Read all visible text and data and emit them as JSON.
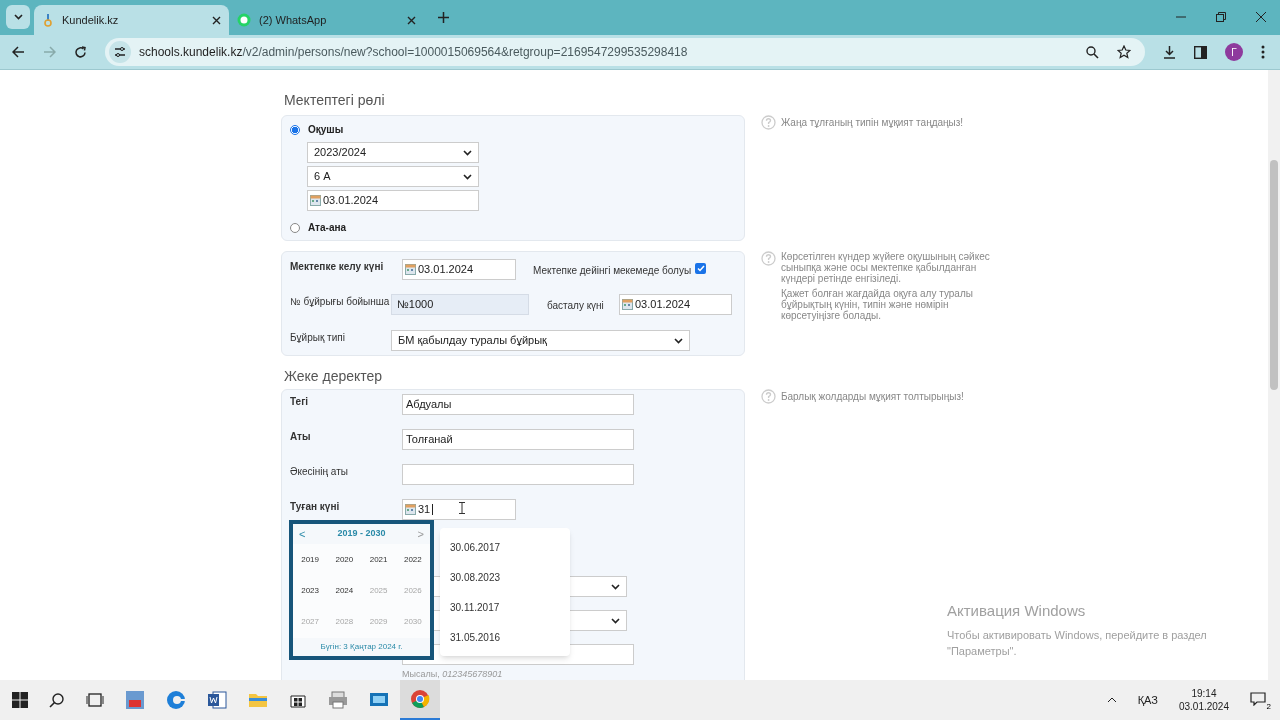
{
  "browser": {
    "tabs": [
      {
        "title": "Kundelik.kz",
        "selected": true,
        "kind": "site"
      },
      {
        "title": "(2) WhatsApp",
        "selected": false,
        "kind": "chat"
      }
    ],
    "url_host": "schools.kundelik.kz",
    "url_path": "/v2/admin/persons/new?school=1000015069564&retgroup=2169547299535298418",
    "profile_initial": "Г"
  },
  "role_section": {
    "heading": "Мектептегі рөлі",
    "hint": "Жаңа тұлғаның типін мұқият таңдаңыз!",
    "options": [
      {
        "label": "Оқушы",
        "selected": true
      },
      {
        "label": "Ата-ана",
        "selected": false
      }
    ],
    "year": "2023/2024",
    "class": "6 А",
    "date": "03.01.2024"
  },
  "admission": {
    "arrival_label": "Мектепке келу күні",
    "arrival_date": "03.01.2024",
    "preschool_label": "Мектепке дейінгі мекемеде болуы",
    "preschool_checked": true,
    "order_label": "№ бұйрығы бойынша",
    "order_number": "№1000",
    "start_label": "басталу күні",
    "start_date": "03.01.2024",
    "type_label": "Бұйрық типі",
    "type_value": "БМ қабылдау туралы бұйрық",
    "hints": [
      "Көрсетілген күндер жүйеге оқушының сәйкес сыныпқа және осы мектепке қабылданған күндері ретінде енгізіледі.",
      "Қажет болған жағдайда оқуға алу туралы бұйрықтың күнін, типін және нөмірін көрсетуіңізге болады."
    ]
  },
  "personal": {
    "heading": "Жеке деректер",
    "hint": "Барлық жолдарды мұқият толтырыңыз!",
    "fields": [
      {
        "label": "Тегі",
        "value": "Абдуалы",
        "required": true,
        "kind": "text"
      },
      {
        "label": "Аты",
        "value": "Толғанай",
        "required": true,
        "kind": "text"
      },
      {
        "label": "Әкесінің аты",
        "required": false,
        "kind": "text"
      },
      {
        "label": "Туған күні",
        "value": "31",
        "required": true,
        "kind": "date"
      }
    ],
    "example_label": "Мысалы,",
    "example_value": "012345678901"
  },
  "year_picker": {
    "range": "2019 - 2030",
    "prev": "<",
    "next": ">",
    "today": "Бүгін: 3 Қаңтар 2024 г.",
    "years": [
      {
        "label": "2019",
        "disabled": false
      },
      {
        "label": "2020",
        "disabled": false
      },
      {
        "label": "2021",
        "disabled": false
      },
      {
        "label": "2022",
        "disabled": false
      },
      {
        "label": "2023",
        "disabled": false
      },
      {
        "label": "2024",
        "disabled": false
      },
      {
        "label": "2025",
        "disabled": true
      },
      {
        "label": "2026",
        "disabled": true
      },
      {
        "label": "2027",
        "disabled": true
      },
      {
        "label": "2028",
        "disabled": true
      },
      {
        "label": "2029",
        "disabled": true
      },
      {
        "label": "2030",
        "disabled": true
      }
    ]
  },
  "suggestions": [
    "30.06.2017",
    "30.08.2023",
    "30.11.2017",
    "31.05.2016"
  ],
  "activation": {
    "title": "Активация Windows",
    "text": "Чтобы активировать Windows, перейдите в раздел \"Параметры\"."
  },
  "taskbar": {
    "language": "ҚАЗ",
    "time": "19:14",
    "date": "03.01.2024",
    "notifications": "2"
  }
}
